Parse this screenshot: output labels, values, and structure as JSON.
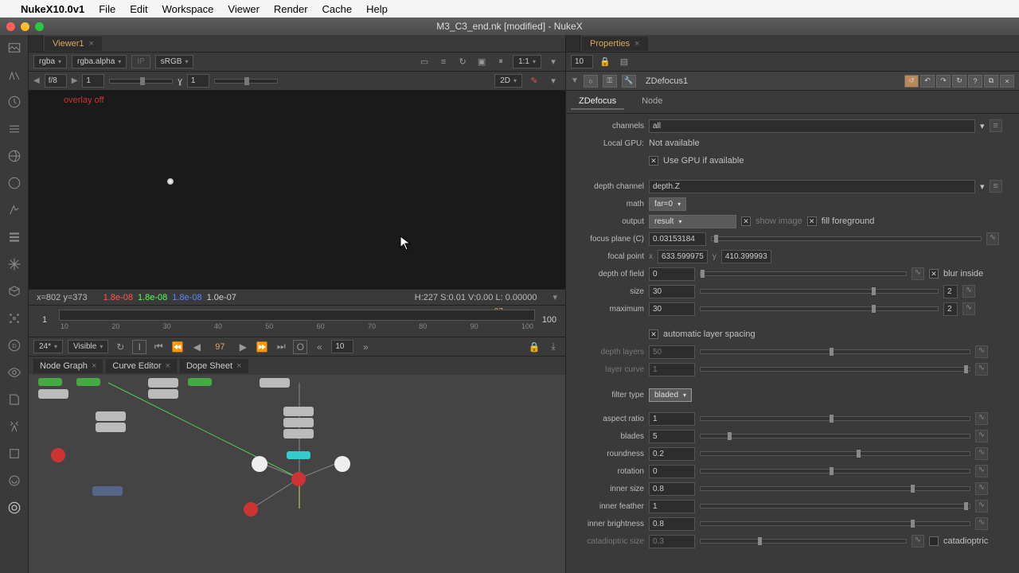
{
  "menubar": {
    "apple": "",
    "app": "NukeX10.0v1",
    "items": [
      "File",
      "Edit",
      "Workspace",
      "Viewer",
      "Render",
      "Cache",
      "Help"
    ]
  },
  "titlebar": "M3_C3_end.nk [modified] - NukeX",
  "viewer": {
    "tab": "Viewer1",
    "chan1": "rgba",
    "chan2": "rgba.alpha",
    "ip": "IP",
    "cspace": "sRGB",
    "zoom": "1:1",
    "fstop": "f/8",
    "fval": "1",
    "yval": "1",
    "dim": "2D",
    "overlay": "overlay off",
    "coord": "x=802 y=373",
    "rgba": {
      "r": "1.8e-08",
      "g": "1.8e-08",
      "b": "1.8e-08",
      "a": "1.0e-07"
    },
    "hsvl": "H:227 S:0.01 V:0.00  L: 0.00000"
  },
  "timeline": {
    "first": "1",
    "last": "100",
    "current": "97",
    "currentTop": "97",
    "ticks": [
      "10",
      "20",
      "30",
      "40",
      "50",
      "60",
      "70",
      "80",
      "90",
      "100"
    ],
    "fps": "24*",
    "vis": "Visible",
    "inc": "10"
  },
  "bottomtabs": [
    "Node Graph",
    "Curve Editor",
    "Dope Sheet"
  ],
  "properties": {
    "title": "Properties",
    "count": "10",
    "node": "ZDefocus1",
    "tabs": [
      "ZDefocus",
      "Node"
    ],
    "channels": "all",
    "localgpu_l": "Local GPU:",
    "localgpu": "Not available",
    "usegpu": "Use GPU if available",
    "depthch_l": "depth channel",
    "depthch": "depth.Z",
    "math_l": "math",
    "math": "far=0",
    "output_l": "output",
    "output": "result",
    "showimg": "show image",
    "fillfg": "fill foreground",
    "focusplane_l": "focus plane (C)",
    "focusplane": "0.03153184",
    "focalpt_l": "focal point",
    "fpx": "633.599975",
    "fpy": "410.399993",
    "dof_l": "depth of field",
    "dof": "0",
    "blurinside": "blur inside",
    "size_l": "size",
    "size": "30",
    "size2": "2",
    "max_l": "maximum",
    "max": "30",
    "max2": "2",
    "autolayer": "automatic layer spacing",
    "depthlayers_l": "depth layers",
    "depthlayers": "50",
    "layercurve_l": "layer curve",
    "layercurve": "1",
    "filtertype_l": "filter type",
    "filtertype": "bladed",
    "aspect_l": "aspect ratio",
    "aspect": "1",
    "blades_l": "blades",
    "blades": "5",
    "roundness_l": "roundness",
    "roundness": "0.2",
    "rotation_l": "rotation",
    "rotation": "0",
    "innersize_l": "inner size",
    "innersize": "0.8",
    "innerfeather_l": "inner feather",
    "innerfeather": "1",
    "innerbright_l": "inner brightness",
    "innerbright": "0.8",
    "catsize_l": "catadioptric size",
    "catsize": "0.3",
    "catadioptric": "catadioptric"
  }
}
